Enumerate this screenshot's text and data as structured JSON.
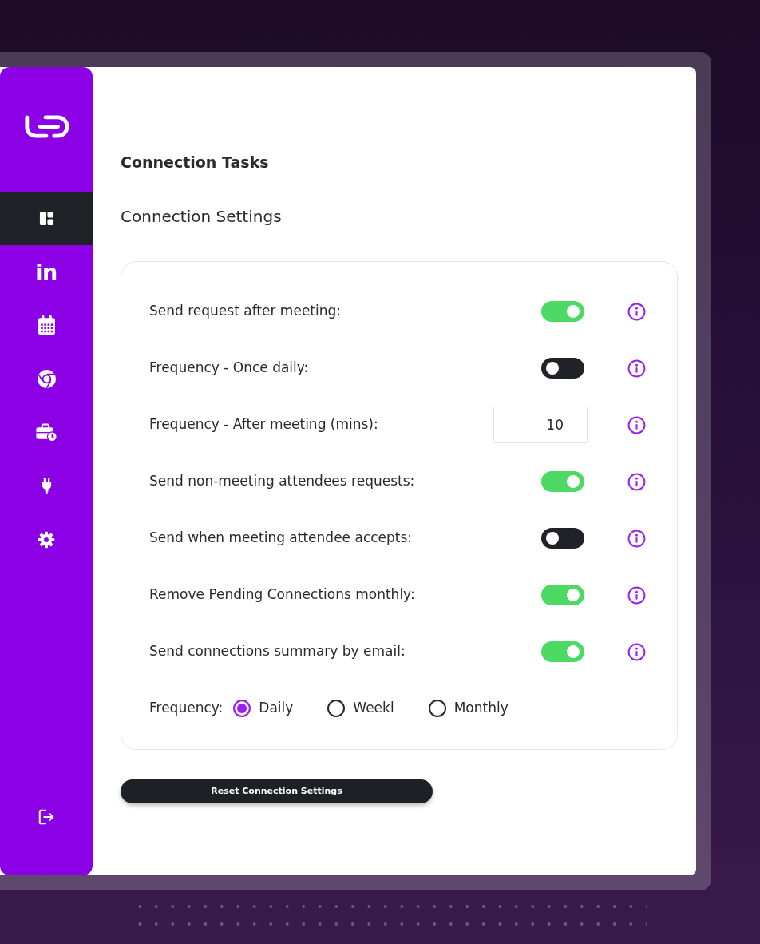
{
  "sidebar": {
    "items": [
      {
        "kind": "dashboard",
        "selected": true
      },
      {
        "kind": "glyph",
        "glyph": "in",
        "selected": false
      },
      {
        "kind": "calendar",
        "selected": false
      },
      {
        "kind": "browser",
        "selected": false
      },
      {
        "kind": "briefcase",
        "selected": false
      },
      {
        "kind": "plug",
        "selected": false
      },
      {
        "kind": "settings",
        "selected": false
      }
    ]
  },
  "page": {
    "title": "Connection Tasks",
    "subtitle": "Connection Settings"
  },
  "settings": [
    {
      "kind": "toggle",
      "label": "Send request after meeting:",
      "on": true
    },
    {
      "kind": "toggle",
      "label": "Frequency - Once daily:",
      "on": false
    },
    {
      "kind": "number",
      "label": "Frequency - After meeting (mins):",
      "value": "10"
    },
    {
      "kind": "toggle",
      "label": "Send non-meeting attendees requests:",
      "on": true
    },
    {
      "kind": "toggle",
      "label": "Send when meeting attendee accepts:",
      "on": false
    },
    {
      "kind": "toggle",
      "label": "Remove Pending Connections monthly:",
      "on": true
    },
    {
      "kind": "toggle",
      "label": "Send connections summary by email:",
      "on": true
    }
  ],
  "summary_frequency": {
    "label": "Frequency:",
    "options": [
      {
        "label": "Daily",
        "selected": true
      },
      {
        "label": "Weekl",
        "selected": false
      },
      {
        "label": "Monthly",
        "selected": false
      }
    ]
  },
  "reset_button": {
    "label": "Reset Connection Settings"
  }
}
